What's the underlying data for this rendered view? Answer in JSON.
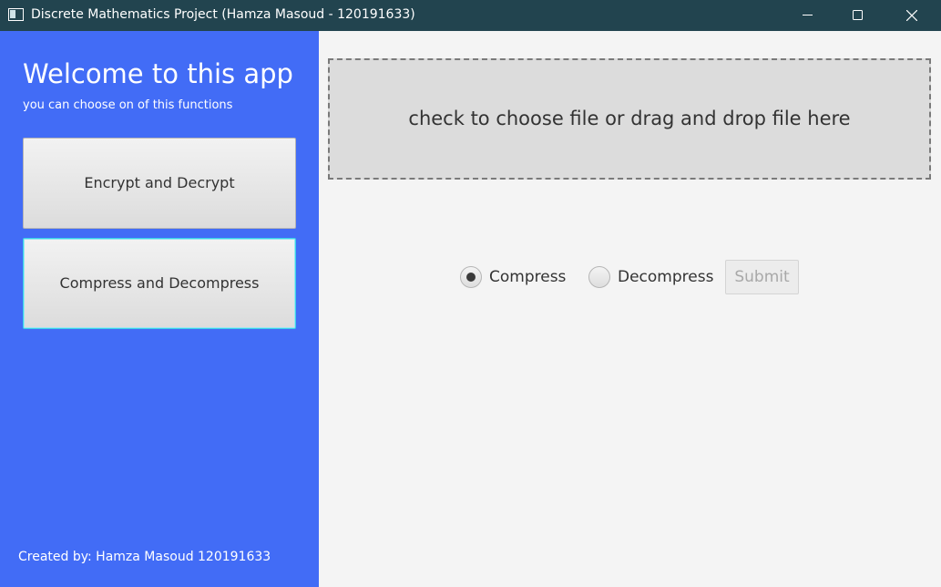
{
  "window": {
    "title": "Discrete Mathematics Project (Hamza Masoud - 120191633)",
    "icon": "app-window-icon",
    "controls": [
      "minimize-icon",
      "maximize-icon",
      "close-icon"
    ]
  },
  "sidebar": {
    "heading": "Welcome to this app",
    "subheading": "you can choose on of this functions",
    "buttons": [
      {
        "label": "Encrypt and Decrypt",
        "focused": false
      },
      {
        "label": "Compress and Decompress",
        "focused": true
      }
    ],
    "credit": "Created by: Hamza Masoud 120191633",
    "background_color": "#426cf6"
  },
  "main": {
    "dropzone_text": "check to choose file or drag and drop file here",
    "options": [
      {
        "label": "Compress",
        "selected": true
      },
      {
        "label": "Decompress",
        "selected": false
      }
    ],
    "submit_label": "Submit",
    "submit_enabled": false
  }
}
